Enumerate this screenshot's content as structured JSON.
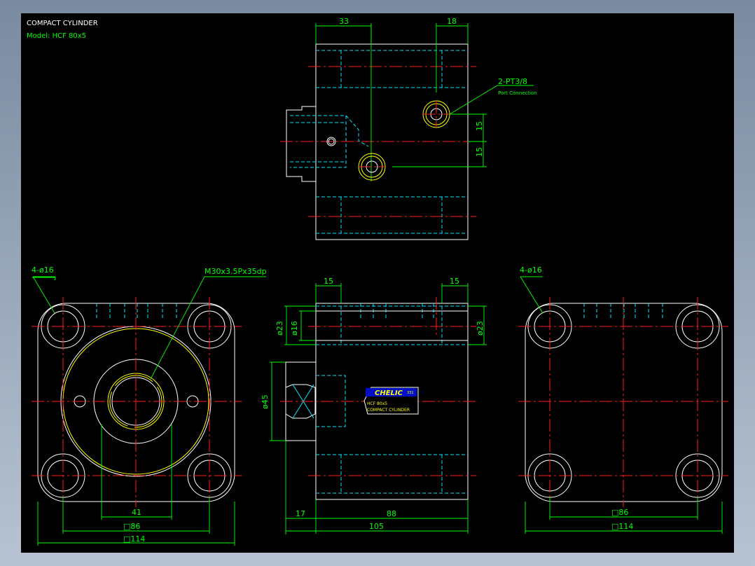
{
  "title": "COMPACT CYLINDER",
  "model": "Model:  HCF 80x5",
  "top_view": {
    "dim_top_left": "33",
    "dim_top_right": "18",
    "port_label": "2-PT3/8",
    "port_sub": "Port Connection",
    "dim_v1": "15",
    "dim_v2": "15"
  },
  "front_view": {
    "hole_label": "4-ø16",
    "thread_label": "M30x3.5Px35dp",
    "dim_41": "41",
    "dim_86": "□86",
    "dim_114": "□114"
  },
  "side_view": {
    "dim_15a": "15",
    "dim_15b": "15",
    "dim_d23_left": "ø23",
    "dim_d16": "ø16",
    "dim_d23_right": "ø23",
    "dim_d45": "ø45",
    "dim_17": "17",
    "dim_88": "88",
    "dim_105": "105",
    "plate_brand": "CHELIC",
    "plate_code": "331",
    "plate_model": "HCF 80x5",
    "plate_name": "COMPACT CYLINDER"
  },
  "rear_view": {
    "hole_label": "4-ø16",
    "dim_86": "□86",
    "dim_114": "□114"
  },
  "colors": {
    "background": "#000000",
    "dimension": "#00ff00",
    "outline": "#ffffff",
    "hidden": "#00e5ff",
    "center": "#ff2020",
    "thread": "#ffff00",
    "plate_blue": "#0010c8"
  }
}
